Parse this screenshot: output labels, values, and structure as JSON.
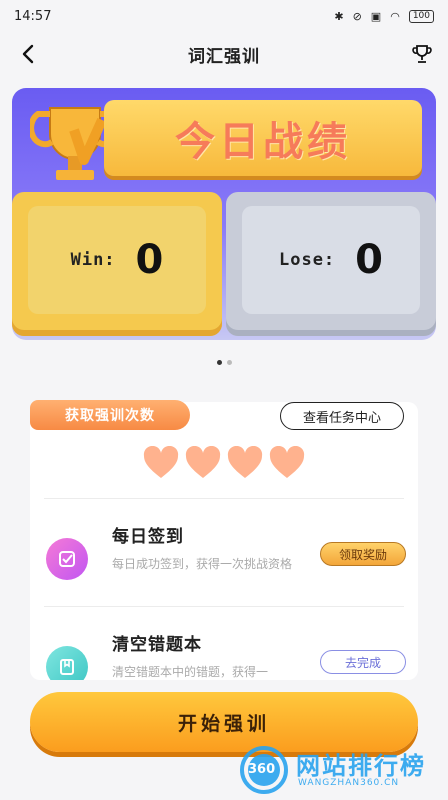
{
  "status_bar": {
    "time": "14:57",
    "battery": "100"
  },
  "header": {
    "title": "词汇强训"
  },
  "banner": {
    "title": "今日战绩"
  },
  "scores": {
    "win_label": "Win:",
    "win_value": "0",
    "lose_label": "Lose:",
    "lose_value": "0"
  },
  "tasks": {
    "chip_title": "获取强训次数",
    "center_button": "查看任务中心",
    "hearts_count": 4,
    "items": [
      {
        "name": "每日签到",
        "desc": "每日成功签到，获得一次挑战资格",
        "button": "领取奖励",
        "icon": "checkbox-icon"
      },
      {
        "name": "清空错题本",
        "desc": "清空错题本中的错题，获得一",
        "button": "去完成",
        "icon": "notebook-icon"
      }
    ]
  },
  "start_button": {
    "label": "开始强训"
  },
  "watermark": {
    "brand": "网站排行榜",
    "sub": "WANGZHAN360.CN",
    "number": "360"
  },
  "colors": {
    "accent": "#fb9d1e",
    "banner": "#6a5cf2",
    "heart": "#ffb28e"
  }
}
